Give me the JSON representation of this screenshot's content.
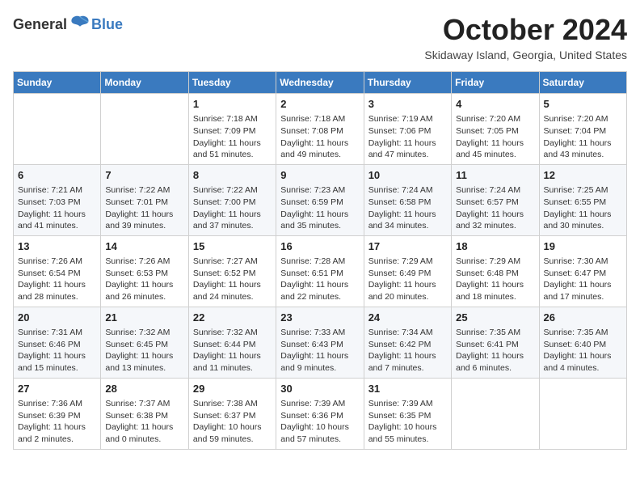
{
  "header": {
    "logo_general": "General",
    "logo_blue": "Blue",
    "month": "October 2024",
    "location": "Skidaway Island, Georgia, United States"
  },
  "weekdays": [
    "Sunday",
    "Monday",
    "Tuesday",
    "Wednesday",
    "Thursday",
    "Friday",
    "Saturday"
  ],
  "weeks": [
    [
      {
        "day": "",
        "sunrise": "",
        "sunset": "",
        "daylight": ""
      },
      {
        "day": "",
        "sunrise": "",
        "sunset": "",
        "daylight": ""
      },
      {
        "day": "1",
        "sunrise": "Sunrise: 7:18 AM",
        "sunset": "Sunset: 7:09 PM",
        "daylight": "Daylight: 11 hours and 51 minutes."
      },
      {
        "day": "2",
        "sunrise": "Sunrise: 7:18 AM",
        "sunset": "Sunset: 7:08 PM",
        "daylight": "Daylight: 11 hours and 49 minutes."
      },
      {
        "day": "3",
        "sunrise": "Sunrise: 7:19 AM",
        "sunset": "Sunset: 7:06 PM",
        "daylight": "Daylight: 11 hours and 47 minutes."
      },
      {
        "day": "4",
        "sunrise": "Sunrise: 7:20 AM",
        "sunset": "Sunset: 7:05 PM",
        "daylight": "Daylight: 11 hours and 45 minutes."
      },
      {
        "day": "5",
        "sunrise": "Sunrise: 7:20 AM",
        "sunset": "Sunset: 7:04 PM",
        "daylight": "Daylight: 11 hours and 43 minutes."
      }
    ],
    [
      {
        "day": "6",
        "sunrise": "Sunrise: 7:21 AM",
        "sunset": "Sunset: 7:03 PM",
        "daylight": "Daylight: 11 hours and 41 minutes."
      },
      {
        "day": "7",
        "sunrise": "Sunrise: 7:22 AM",
        "sunset": "Sunset: 7:01 PM",
        "daylight": "Daylight: 11 hours and 39 minutes."
      },
      {
        "day": "8",
        "sunrise": "Sunrise: 7:22 AM",
        "sunset": "Sunset: 7:00 PM",
        "daylight": "Daylight: 11 hours and 37 minutes."
      },
      {
        "day": "9",
        "sunrise": "Sunrise: 7:23 AM",
        "sunset": "Sunset: 6:59 PM",
        "daylight": "Daylight: 11 hours and 35 minutes."
      },
      {
        "day": "10",
        "sunrise": "Sunrise: 7:24 AM",
        "sunset": "Sunset: 6:58 PM",
        "daylight": "Daylight: 11 hours and 34 minutes."
      },
      {
        "day": "11",
        "sunrise": "Sunrise: 7:24 AM",
        "sunset": "Sunset: 6:57 PM",
        "daylight": "Daylight: 11 hours and 32 minutes."
      },
      {
        "day": "12",
        "sunrise": "Sunrise: 7:25 AM",
        "sunset": "Sunset: 6:55 PM",
        "daylight": "Daylight: 11 hours and 30 minutes."
      }
    ],
    [
      {
        "day": "13",
        "sunrise": "Sunrise: 7:26 AM",
        "sunset": "Sunset: 6:54 PM",
        "daylight": "Daylight: 11 hours and 28 minutes."
      },
      {
        "day": "14",
        "sunrise": "Sunrise: 7:26 AM",
        "sunset": "Sunset: 6:53 PM",
        "daylight": "Daylight: 11 hours and 26 minutes."
      },
      {
        "day": "15",
        "sunrise": "Sunrise: 7:27 AM",
        "sunset": "Sunset: 6:52 PM",
        "daylight": "Daylight: 11 hours and 24 minutes."
      },
      {
        "day": "16",
        "sunrise": "Sunrise: 7:28 AM",
        "sunset": "Sunset: 6:51 PM",
        "daylight": "Daylight: 11 hours and 22 minutes."
      },
      {
        "day": "17",
        "sunrise": "Sunrise: 7:29 AM",
        "sunset": "Sunset: 6:49 PM",
        "daylight": "Daylight: 11 hours and 20 minutes."
      },
      {
        "day": "18",
        "sunrise": "Sunrise: 7:29 AM",
        "sunset": "Sunset: 6:48 PM",
        "daylight": "Daylight: 11 hours and 18 minutes."
      },
      {
        "day": "19",
        "sunrise": "Sunrise: 7:30 AM",
        "sunset": "Sunset: 6:47 PM",
        "daylight": "Daylight: 11 hours and 17 minutes."
      }
    ],
    [
      {
        "day": "20",
        "sunrise": "Sunrise: 7:31 AM",
        "sunset": "Sunset: 6:46 PM",
        "daylight": "Daylight: 11 hours and 15 minutes."
      },
      {
        "day": "21",
        "sunrise": "Sunrise: 7:32 AM",
        "sunset": "Sunset: 6:45 PM",
        "daylight": "Daylight: 11 hours and 13 minutes."
      },
      {
        "day": "22",
        "sunrise": "Sunrise: 7:32 AM",
        "sunset": "Sunset: 6:44 PM",
        "daylight": "Daylight: 11 hours and 11 minutes."
      },
      {
        "day": "23",
        "sunrise": "Sunrise: 7:33 AM",
        "sunset": "Sunset: 6:43 PM",
        "daylight": "Daylight: 11 hours and 9 minutes."
      },
      {
        "day": "24",
        "sunrise": "Sunrise: 7:34 AM",
        "sunset": "Sunset: 6:42 PM",
        "daylight": "Daylight: 11 hours and 7 minutes."
      },
      {
        "day": "25",
        "sunrise": "Sunrise: 7:35 AM",
        "sunset": "Sunset: 6:41 PM",
        "daylight": "Daylight: 11 hours and 6 minutes."
      },
      {
        "day": "26",
        "sunrise": "Sunrise: 7:35 AM",
        "sunset": "Sunset: 6:40 PM",
        "daylight": "Daylight: 11 hours and 4 minutes."
      }
    ],
    [
      {
        "day": "27",
        "sunrise": "Sunrise: 7:36 AM",
        "sunset": "Sunset: 6:39 PM",
        "daylight": "Daylight: 11 hours and 2 minutes."
      },
      {
        "day": "28",
        "sunrise": "Sunrise: 7:37 AM",
        "sunset": "Sunset: 6:38 PM",
        "daylight": "Daylight: 11 hours and 0 minutes."
      },
      {
        "day": "29",
        "sunrise": "Sunrise: 7:38 AM",
        "sunset": "Sunset: 6:37 PM",
        "daylight": "Daylight: 10 hours and 59 minutes."
      },
      {
        "day": "30",
        "sunrise": "Sunrise: 7:39 AM",
        "sunset": "Sunset: 6:36 PM",
        "daylight": "Daylight: 10 hours and 57 minutes."
      },
      {
        "day": "31",
        "sunrise": "Sunrise: 7:39 AM",
        "sunset": "Sunset: 6:35 PM",
        "daylight": "Daylight: 10 hours and 55 minutes."
      },
      {
        "day": "",
        "sunrise": "",
        "sunset": "",
        "daylight": ""
      },
      {
        "day": "",
        "sunrise": "",
        "sunset": "",
        "daylight": ""
      }
    ]
  ]
}
